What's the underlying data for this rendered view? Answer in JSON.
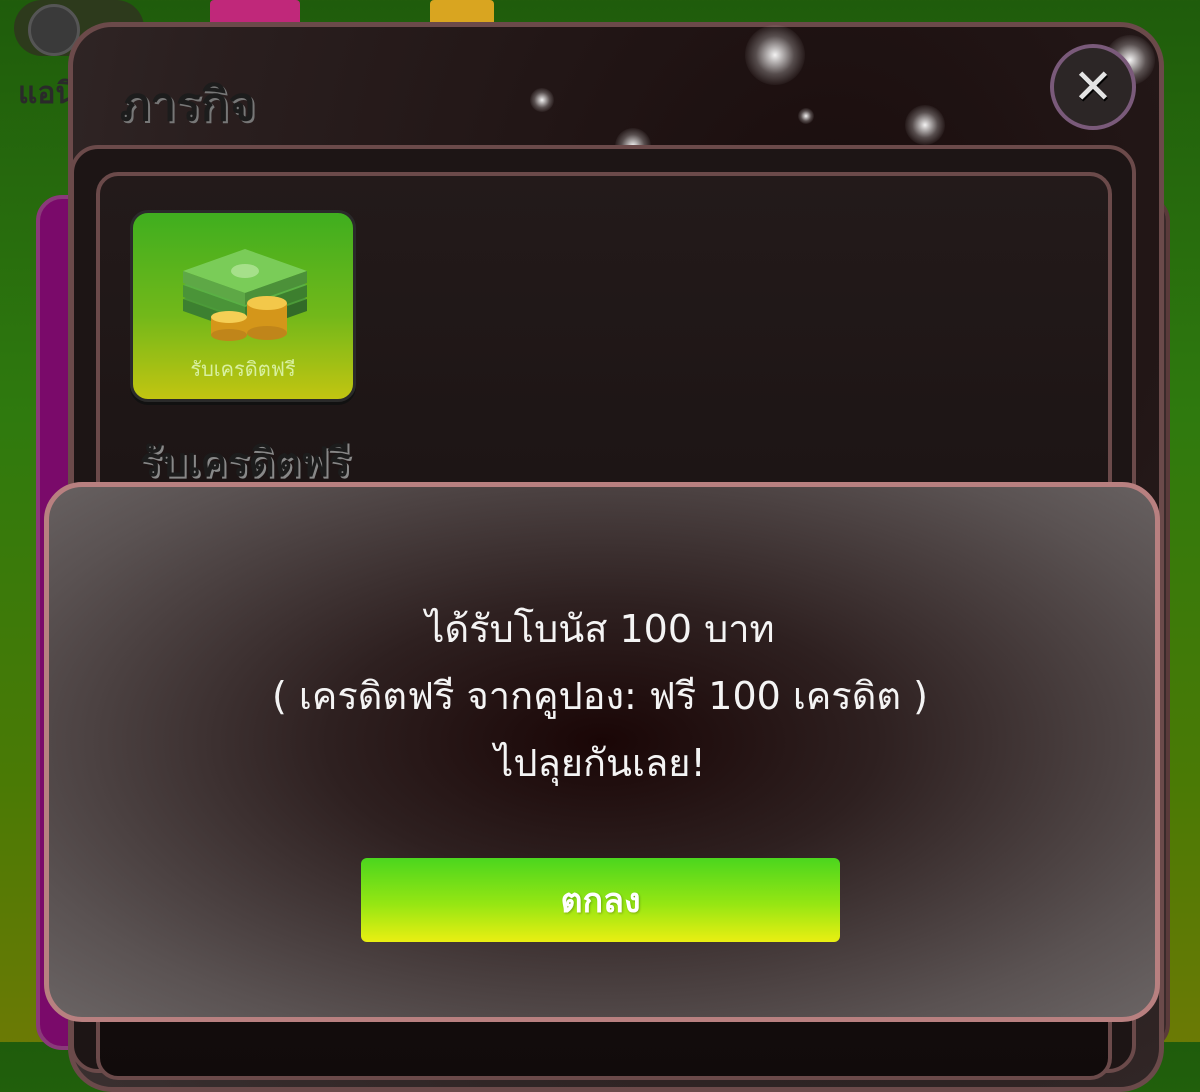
{
  "background": {
    "toggle_label": "แอนิ"
  },
  "panel": {
    "title": "ภารกิจ",
    "close_icon": "close-icon"
  },
  "reward": {
    "card_label": "รับเครดิตฟรี",
    "title": "รับเครดิตฟรี",
    "icon": "money-stack-coins-icon"
  },
  "dialog": {
    "line1": "ได้รับโบนัส 100 บาท",
    "line2": "( เครดิตฟรี จากคูปอง: ฟรี 100 เครดิต )",
    "line3": "ไปลุยกันเลย!",
    "confirm_label": "ตกลง"
  },
  "colors": {
    "confirm_button_top": "#4bd61e",
    "confirm_button_bottom": "#eaef12",
    "dialog_border": "#b88080",
    "panel_border": "#6b4a4a"
  }
}
